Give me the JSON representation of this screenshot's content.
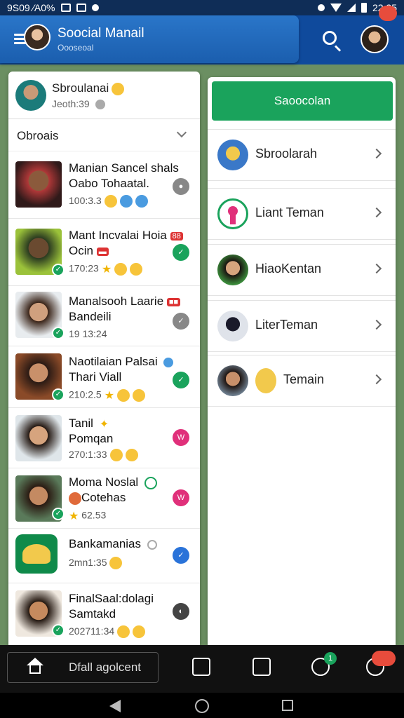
{
  "status_bar": {
    "left_text": "9S09 ⁄A0%",
    "time": "22:25"
  },
  "app_bar": {
    "title": "Soocial Manail",
    "subtitle": "Oooseoal",
    "notification_count": ""
  },
  "me": {
    "name": "Sbroulanai",
    "time": "Jeoth:39"
  },
  "contacts_section": {
    "title": "Obroais"
  },
  "contacts": [
    {
      "line1": "Manian Sancel shals",
      "line2": "Oabo Tohaatal.",
      "time": "100:3.3",
      "status_color": "#888888"
    },
    {
      "line1": "Mant Incvalai Hoia",
      "line2": "Ocin",
      "time": "170:23",
      "status_color": "#1aa35c"
    },
    {
      "line1": "Manalsooh Laarie",
      "line2": "Bandeili",
      "time": "19 13:24",
      "status_color": "#888888"
    },
    {
      "line1": "Naotilaian Palsai",
      "line2": "Thari Viall",
      "time": "210:2.5",
      "status_color": "#1aa35c"
    },
    {
      "line1": "Tanil",
      "line2": "Pomqan",
      "time": "270:1:33",
      "status_color": "#e0307a"
    },
    {
      "line1": "Moma Noslal",
      "line2": "Cotehas",
      "time": "62.53",
      "status_color": "#e0307a"
    },
    {
      "line1": "Bankamanias",
      "line2": "",
      "time": "2mn1:35",
      "status_color": "#2a73d9"
    },
    {
      "line1": "FinalSaal:dolagi",
      "line2": "Samtakd",
      "time": "202711:34",
      "status_color": "#444444"
    }
  ],
  "right_panel": {
    "primary_button": "Saoocolan",
    "items": [
      {
        "label": "Sbroolarah"
      },
      {
        "label": "Liant Teman"
      },
      {
        "label": "HiaoKentan"
      },
      {
        "label": "LiterTeman"
      },
      {
        "label": "Temain"
      }
    ]
  },
  "bottom_nav": {
    "label": "Dfall agolcent",
    "badge_a": "1"
  },
  "icons": [
    "menu-icon",
    "search-icon",
    "home-icon",
    "bag-icon",
    "chat-icon",
    "timer-icon",
    "message-icon",
    "back-icon",
    "circle-home-icon",
    "recents-icon"
  ]
}
